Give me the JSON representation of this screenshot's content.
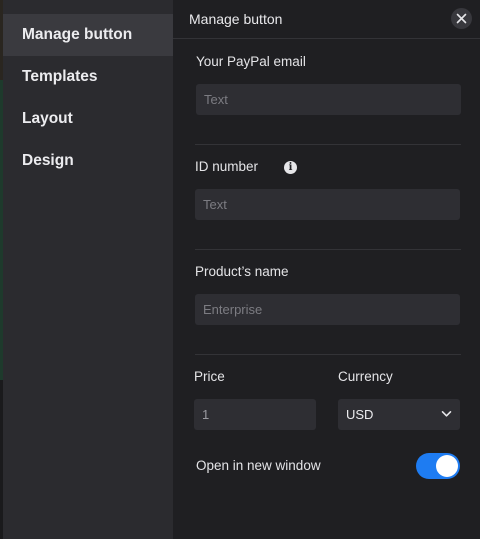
{
  "sidebar": {
    "items": [
      {
        "label": "Manage button",
        "active": true
      },
      {
        "label": "Templates"
      },
      {
        "label": "Layout"
      },
      {
        "label": "Design"
      }
    ]
  },
  "panel": {
    "title": "Manage button",
    "paypal_email": {
      "label": "Your PayPal email",
      "placeholder": "Text",
      "value": ""
    },
    "id_number": {
      "label": "ID number",
      "info_icon": "info-icon",
      "placeholder": "Text",
      "value": ""
    },
    "product_name": {
      "label": "Product’s name",
      "placeholder": "Enterprise",
      "value": ""
    },
    "price": {
      "label": "Price",
      "value": "1"
    },
    "currency": {
      "label": "Currency",
      "selected": "USD"
    },
    "open_new_window": {
      "label": "Open in new window",
      "enabled": true
    }
  },
  "colors": {
    "accent": "#1e7cf2",
    "sidebar_bg": "#2b2b2f",
    "panel_bg": "#1f1f22",
    "input_bg": "#2e2e33"
  }
}
